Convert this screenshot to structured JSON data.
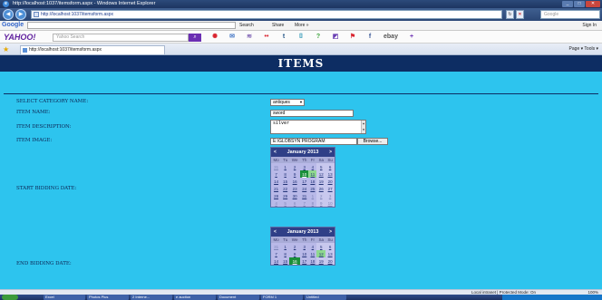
{
  "window": {
    "title": "http://localhost:1037/itemsform.aspx - Windows Internet Explorer",
    "address": "http://localhost:1037/itemsform.aspx",
    "search_placeholder": "Google"
  },
  "google_toolbar": {
    "logo": "Google",
    "search_label": "Search",
    "share_label": "Share",
    "more_label": "More »",
    "signin_label": "Sign In"
  },
  "yahoo_toolbar": {
    "logo": "YAHOO!",
    "search_placeholder": "Yahoo Search",
    "ebay_label": "ebay"
  },
  "tabbar": {
    "tab_title": "http://localhost:1037/itemsform.aspx",
    "commands": "Page ▾  Tools ▾"
  },
  "page": {
    "title": "ITEMS",
    "labels": {
      "category": "SELECT CATEGORY NAME:",
      "item_name": "ITEM NAME:",
      "description": "ITEM DESCRIPTION:",
      "image": "ITEM IMAGE:",
      "start_date": "START BIDDING DATE:",
      "end_date": "END BIDDING DATE:"
    },
    "category_value": "antiques",
    "item_name_value": "sword",
    "description_value": "silver",
    "file_path": "E:\\GLOBSYN PROGRAM",
    "browse_label": "Browse...",
    "calendar1": {
      "month": "January 2013",
      "prev": "<",
      "next": ">",
      "days": [
        "Mo",
        "Tu",
        "We",
        "Th",
        "Fr",
        "Sa",
        "Su"
      ],
      "weeks": [
        [
          "31",
          "1",
          "2",
          "3",
          "4",
          "5",
          "6"
        ],
        [
          "7",
          "8",
          "9",
          "10",
          "11",
          "12",
          "13"
        ],
        [
          "14",
          "15",
          "16",
          "17",
          "18",
          "19",
          "20"
        ],
        [
          "21",
          "22",
          "23",
          "24",
          "25",
          "26",
          "27"
        ],
        [
          "28",
          "29",
          "30",
          "31",
          "1",
          "2",
          "3"
        ],
        [
          "4",
          "5",
          "6",
          "7",
          "8",
          "9",
          "10"
        ]
      ]
    },
    "calendar2": {
      "month": "January 2013",
      "prev": "<",
      "next": ">",
      "days": [
        "Mo",
        "Tu",
        "We",
        "Th",
        "Fr",
        "Sa",
        "Su"
      ],
      "weeks": [
        [
          "31",
          "1",
          "2",
          "3",
          "4",
          "5",
          "6"
        ],
        [
          "7",
          "8",
          "9",
          "10",
          "11",
          "12",
          "13"
        ],
        [
          "14",
          "15",
          "16",
          "17",
          "18",
          "19",
          "20"
        ]
      ]
    }
  },
  "statusbar": {
    "zone": "Local intranet | Protected Mode: On",
    "zoom": "100%"
  },
  "taskbar": {
    "tasks": [
      "Excel",
      "Photos Plus",
      "2 Interne...",
      "e auction",
      "Document",
      "FORM 1",
      "Untitled"
    ]
  }
}
